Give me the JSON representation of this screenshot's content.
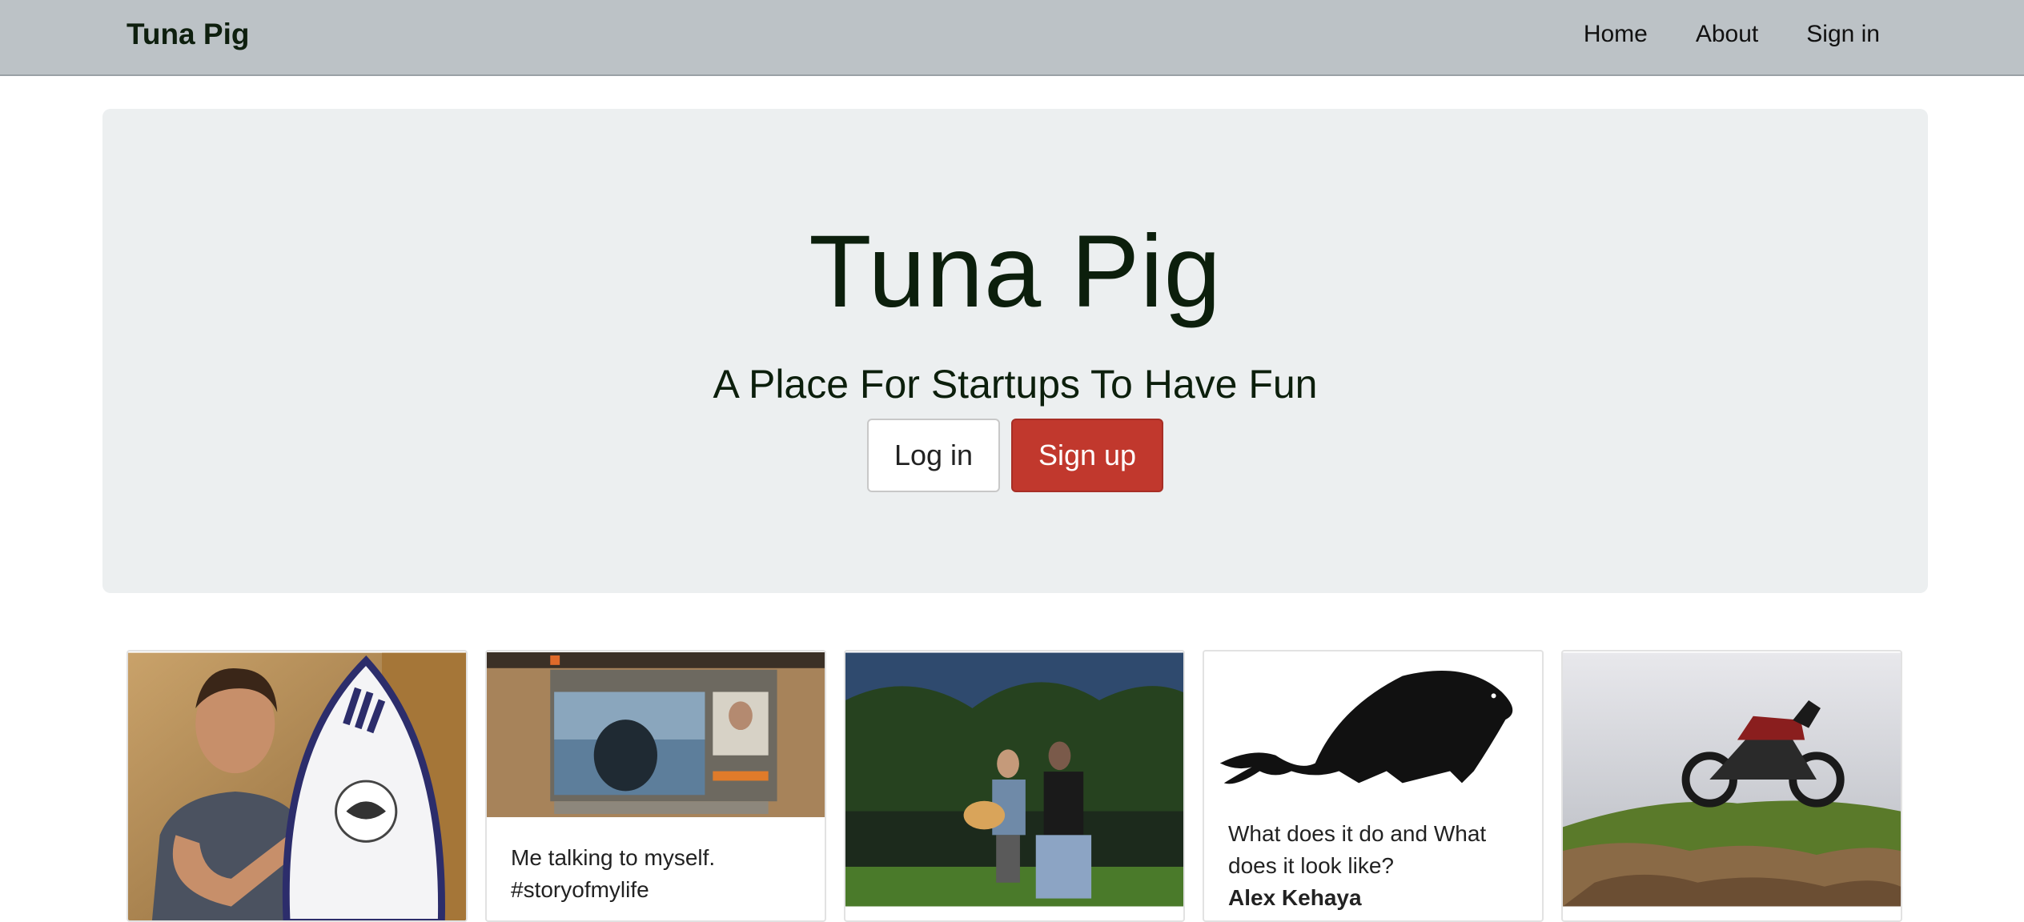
{
  "navbar": {
    "brand": "Tuna Pig",
    "links": [
      "Home",
      "About",
      "Sign in"
    ]
  },
  "hero": {
    "title": "Tuna Pig",
    "subtitle": "A Place For Startups To Have Fun",
    "login_label": "Log in",
    "signup_label": "Sign up"
  },
  "cards": [
    {
      "image": "surfer-with-surfboard-photo",
      "text": "",
      "author": ""
    },
    {
      "image": "video-chat-screenshot",
      "text": "Me talking to myself. #storyofmylife",
      "author": ""
    },
    {
      "image": "guitar-players-night-photo",
      "text": "",
      "author": ""
    },
    {
      "image": "tuna-pig-silhouette",
      "text": "What does it do and What does it look like?",
      "author": "Alex Kehaya"
    },
    {
      "image": "motorcycle-on-rocks-photo",
      "text": "",
      "author": ""
    }
  ],
  "colors": {
    "navbar_bg": "#bcc2c6",
    "hero_bg": "#eceff0",
    "signup_button": "#c1382d",
    "title_text": "#0c1f0c"
  }
}
